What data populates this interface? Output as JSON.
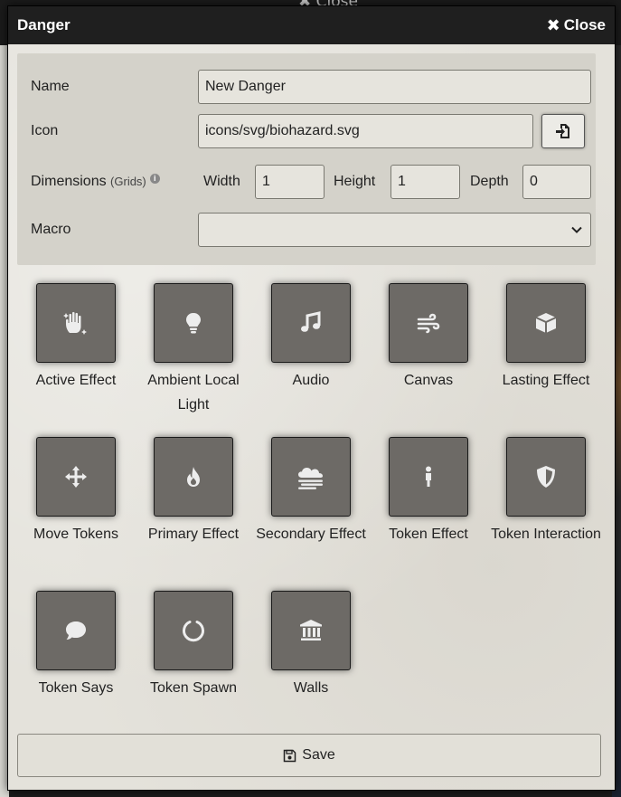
{
  "background": {
    "close_label": "Close"
  },
  "window": {
    "title": "Danger",
    "close_label": "Close"
  },
  "form": {
    "name": {
      "label": "Name",
      "value": "New Danger"
    },
    "icon": {
      "label": "Icon",
      "value": "icons/svg/biohazard.svg",
      "picker_icon": "file-import-icon"
    },
    "dimensions": {
      "label": "Dimensions",
      "unit": "(Grids)",
      "width": {
        "label": "Width",
        "value": "1"
      },
      "height": {
        "label": "Height",
        "value": "1"
      },
      "depth": {
        "label": "Depth",
        "value": "0"
      }
    },
    "macro": {
      "label": "Macro",
      "value": ""
    }
  },
  "effects": [
    {
      "label": "Active Effect",
      "icon": "hand-sparkles-icon"
    },
    {
      "label": "Ambient Local Light",
      "icon": "lightbulb-icon"
    },
    {
      "label": "Audio",
      "icon": "music-icon"
    },
    {
      "label": "Canvas",
      "icon": "wind-icon"
    },
    {
      "label": "Lasting Effect",
      "icon": "cube-icon"
    },
    {
      "label": "Move Tokens",
      "icon": "arrows-move-icon"
    },
    {
      "label": "Primary Effect",
      "icon": "fire-icon"
    },
    {
      "label": "Secondary Effect",
      "icon": "cloud-fog-icon"
    },
    {
      "label": "Token Effect",
      "icon": "person-icon"
    },
    {
      "label": "Token Interaction",
      "icon": "shield-icon"
    },
    {
      "label": "Token Says",
      "icon": "comment-icon"
    },
    {
      "label": "Token Spawn",
      "icon": "circle-notch-icon"
    },
    {
      "label": "Walls",
      "icon": "landmark-icon"
    }
  ],
  "save": {
    "label": "Save",
    "icon": "save-icon"
  }
}
